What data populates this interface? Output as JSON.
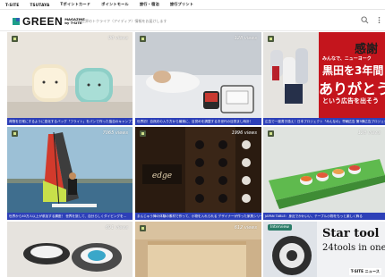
{
  "topnav": [
    "T-SITE",
    "TSUTAYA",
    "Tポイントカード",
    "ポイントモール",
    "旅行・宿泊",
    "旅行プリント"
  ],
  "header": {
    "logo_word": "GREEN",
    "logo_sub1": "MAGAZINE",
    "logo_sub2": "by T-SITE",
    "tagline": "世界のトクライフ〈アイディア〉情報をお届けします",
    "search_icon": "search-icon",
    "menu_icon": "more-vertical-icon"
  },
  "tiles": [
    {
      "views": "90 views",
      "caption": "荷物を日常にするように変化するバッグ「フライト」をパンで作った独自のキャンプアイテム 目線",
      "colors": [
        "#e9d9c9",
        "#b9a98f"
      ]
    },
    {
      "views": "128 views",
      "caption": "世界初！自然光の入り方から最適に、目覚めを調整する次世代の目覚まし時計！",
      "colors": [
        "#b9bfc6",
        "#6a7079"
      ]
    },
    {
      "views": "",
      "caption": "広告で一度書き換え！日本プロジェクト「みんなの」早朝広告 第3弾広告プロジェクト",
      "colors": [
        "#c0181e",
        "#7b1015"
      ],
      "ad_line1": "感謝",
      "ad_line2": "みんなで、ニューヨーク",
      "ad_line3": "黒田を3年間",
      "ad_line4": "ありがとう",
      "ad_line5": "という広告を出そう"
    },
    {
      "views": "7065 views",
      "caption": "世界から40万人以上が参加する講座！ 世界を旅して、自分らしくダイビングを…",
      "colors": [
        "#8fb8d2",
        "#2d5a7c"
      ]
    },
    {
      "views": "1996 views",
      "caption": "まんじゅう陣の体験の素材で作って、小物を入れられる デザイナーが作った家具シリーズ",
      "colors": [
        "#5a3b24",
        "#1e140c"
      ]
    },
    {
      "views": "128 views",
      "caption": "JAPAN TABLE：身近でかわいい、テーブル小物をもっと楽しく飾る",
      "colors": [
        "#e4e7e4",
        "#b7bcb6"
      ]
    },
    {
      "views": "691 views",
      "caption": "",
      "colors": [
        "#e8e5e0",
        "#8a8780"
      ]
    },
    {
      "views": "612 views",
      "caption": "",
      "colors": [
        "#d7bf98",
        "#a88a5c"
      ]
    },
    {
      "views": "",
      "caption": "",
      "colors": [
        "#eef0f2",
        "#c6cacf"
      ],
      "pill": "Interview",
      "star1": "Star tool",
      "star2": "24tools in one",
      "tsite": "T-SITE ニュース"
    }
  ]
}
